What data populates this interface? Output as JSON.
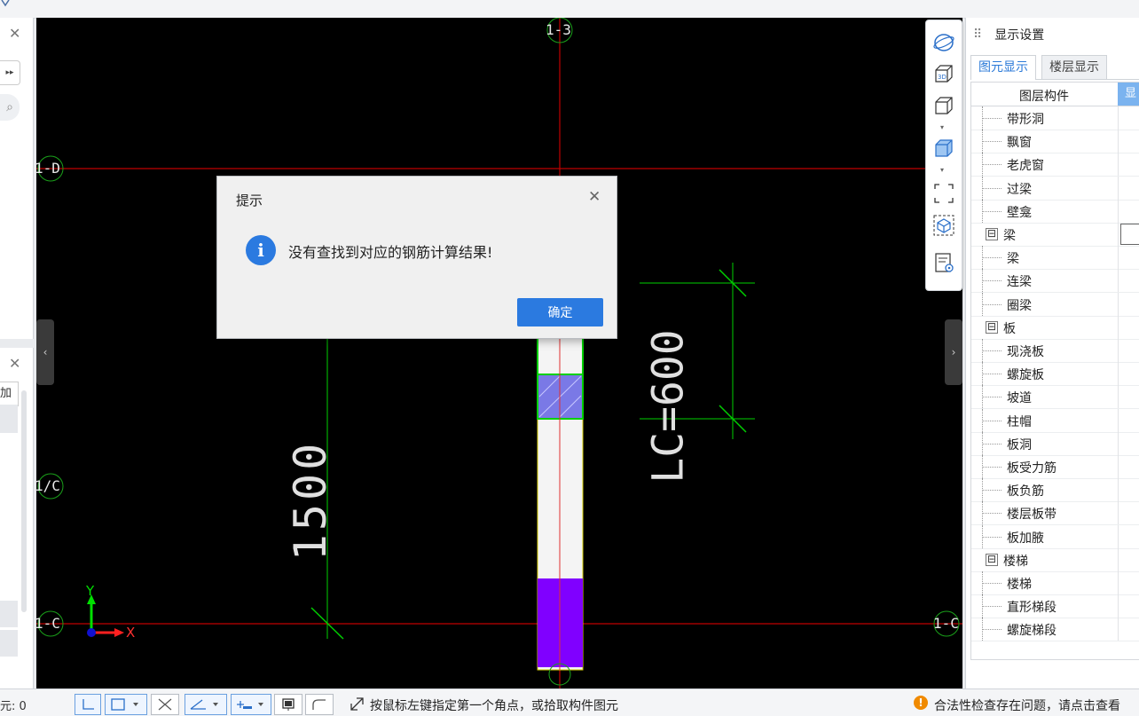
{
  "dialog": {
    "title": "提示",
    "message": "没有查找到对应的钢筋计算结果!",
    "ok_label": "确定"
  },
  "canvas": {
    "axis_labels": {
      "top": "1-3",
      "d": "1-D",
      "c_slash": "1/C",
      "c_left": "1-C",
      "c_right": "1-C"
    },
    "dim_1500": "1500",
    "dim_lc": "LC=600",
    "axis_x": "X",
    "axis_y": "Y"
  },
  "right_panel": {
    "title": "显示设置",
    "tabs": [
      "图元显示",
      "楼层显示"
    ],
    "column_header": "图层构件",
    "column_header_right": "显",
    "rows": [
      {
        "label": "带形洞",
        "level": 2
      },
      {
        "label": "飘窗",
        "level": 2
      },
      {
        "label": "老虎窗",
        "level": 2
      },
      {
        "label": "过梁",
        "level": 2
      },
      {
        "label": "壁龛",
        "level": 2
      },
      {
        "label": "梁",
        "level": 1
      },
      {
        "label": "梁",
        "level": 2
      },
      {
        "label": "连梁",
        "level": 2
      },
      {
        "label": "圈梁",
        "level": 2
      },
      {
        "label": "板",
        "level": 1
      },
      {
        "label": "现浇板",
        "level": 2
      },
      {
        "label": "螺旋板",
        "level": 2
      },
      {
        "label": "坡道",
        "level": 2
      },
      {
        "label": "柱帽",
        "level": 2
      },
      {
        "label": "板洞",
        "level": 2
      },
      {
        "label": "板受力筋",
        "level": 2
      },
      {
        "label": "板负筋",
        "level": 2
      },
      {
        "label": "楼层板带",
        "level": 2
      },
      {
        "label": "板加腋",
        "level": 2
      },
      {
        "label": "楼梯",
        "level": 1
      },
      {
        "label": "楼梯",
        "level": 2
      },
      {
        "label": "直形梯段",
        "level": 2
      },
      {
        "label": "螺旋梯段",
        "level": 2
      }
    ]
  },
  "left_panel": {
    "partial_label": "加",
    "expander_glyph": "⊟"
  },
  "status_bar": {
    "count_text": "元: 0",
    "hint": "按鼠标左键指定第一个角点，或拾取构件图元",
    "warning": "合法性检查存在问题，请点击查看"
  },
  "icons": {
    "close": "✕",
    "info": "i",
    "warning": "!",
    "grip": "⠿",
    "left_handle": "‹",
    "right_handle": "›",
    "search": "⌕",
    "next": "▸▸",
    "caret": "▾"
  },
  "view_toolbar": {
    "label_3d": "3D"
  },
  "colors": {
    "accent": "#2b7ae0",
    "axis_red": "#c00000",
    "dim_green": "#00d000",
    "column_blue": "#7a79e6",
    "column_purple": "#8000ff",
    "warning_orange": "#f08a00"
  }
}
